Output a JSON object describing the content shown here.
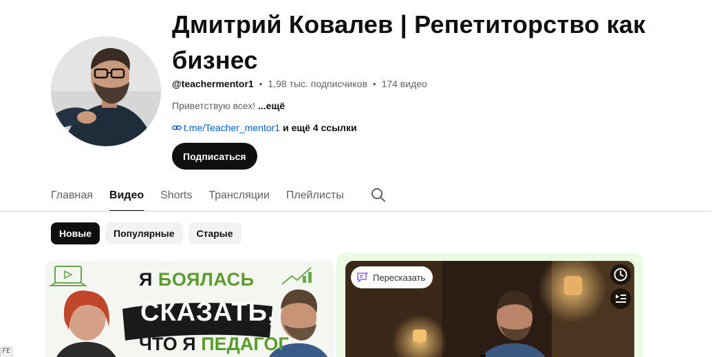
{
  "channel": {
    "name": "Дмитрий Ковалев | Репетиторство как бизнес",
    "handle": "@teachermentor1",
    "separator": "•",
    "subscribers": "1,98 тыс. подписчиков",
    "videos": "174 видео",
    "description": "Приветствую всех!",
    "description_more": "...ещё",
    "link": "t.me/Teacher_mentor1",
    "more_links": "и ещё 4 ссылки",
    "subscribe_label": "Подписаться"
  },
  "tabs": [
    {
      "label": "Главная",
      "active": false
    },
    {
      "label": "Видео",
      "active": true
    },
    {
      "label": "Shorts",
      "active": false
    },
    {
      "label": "Трансляции",
      "active": false
    },
    {
      "label": "Плейлисты",
      "active": false
    }
  ],
  "icons": {
    "tab_search": "search-icon",
    "link": "link-icon",
    "retell": "retell-icon",
    "watch_later": "clock-icon",
    "add_to_queue": "queue-icon"
  },
  "chips": [
    {
      "label": "Новые",
      "active": true
    },
    {
      "label": "Популярные",
      "active": false
    },
    {
      "label": "Старые",
      "active": false
    }
  ],
  "videos": [
    {
      "thumb_text_lines": [
        "Я",
        "БОЯЛАСЬ",
        "СКАЗАТЬ,",
        "ЧТО Я",
        "ПЕДАГОГ"
      ]
    },
    {
      "retell_label": "Пересказать"
    }
  ],
  "corner_badge": "FE",
  "colors": {
    "link": "#065fd4",
    "accent_green": "#5b9c2c",
    "highlight_bg": "#eafbe1"
  }
}
